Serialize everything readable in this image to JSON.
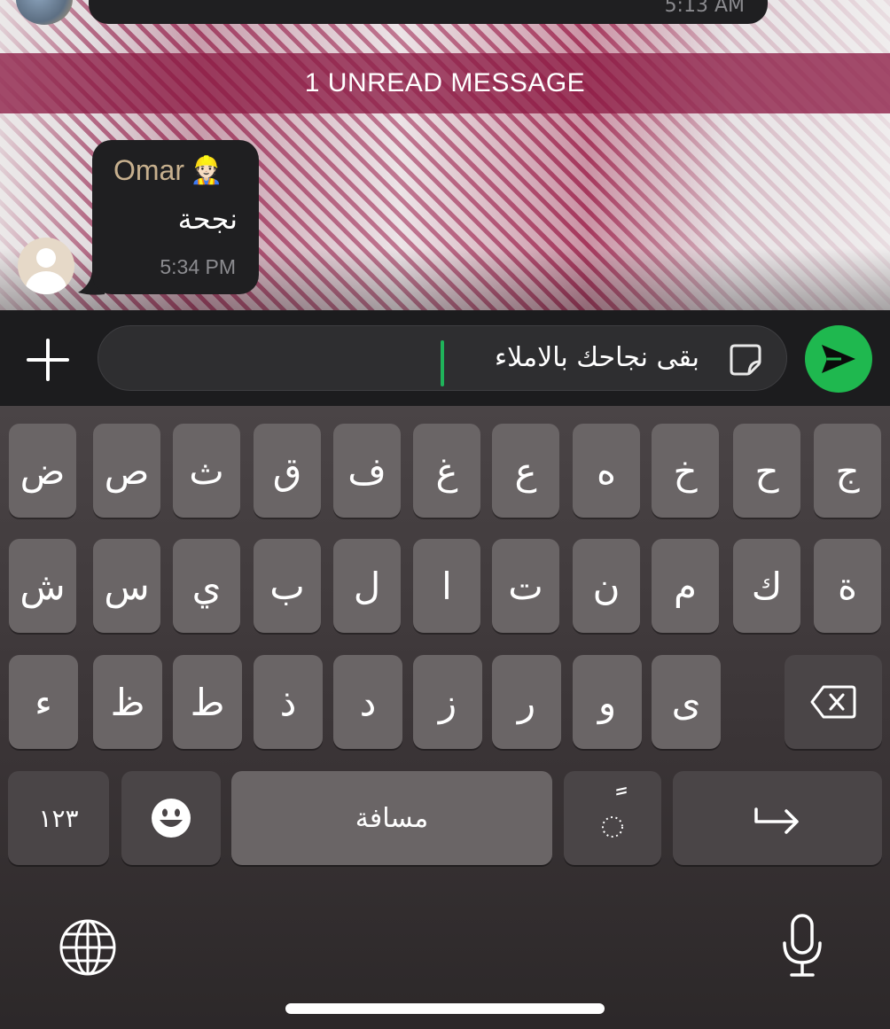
{
  "chat": {
    "previous_message_time": "5:13 AM",
    "unread_banner": "1 UNREAD MESSAGE",
    "message": {
      "sender": "Omar",
      "sender_emoji": "👷🏻",
      "text": "نجحة",
      "time": "5:34 PM"
    }
  },
  "composer": {
    "value": "بقى نجاحك بالاملاء",
    "icons": [
      "plus-icon",
      "sticker-icon",
      "send-icon"
    ],
    "accent": "#1fb84f"
  },
  "keyboard": {
    "row1": [
      "ج",
      "ح",
      "خ",
      "ه",
      "ع",
      "غ",
      "ف",
      "ق",
      "ث",
      "ص",
      "ض"
    ],
    "row2": [
      "ة",
      "ك",
      "م",
      "ن",
      "ت",
      "ا",
      "ل",
      "ب",
      "ي",
      "س",
      "ش"
    ],
    "row3": [
      "ى",
      "و",
      "ر",
      "ز",
      "د",
      "ذ",
      "ط",
      "ظ",
      "ء"
    ],
    "numbers_label": "١٢٣",
    "space_label": "مسافة",
    "tanween_label": "ً",
    "icons": [
      "backspace-icon",
      "emoji-icon",
      "return-icon",
      "globe-icon",
      "microphone-icon"
    ]
  }
}
